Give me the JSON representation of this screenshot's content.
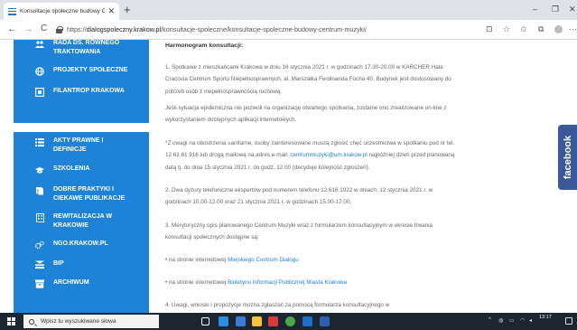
{
  "browser": {
    "tab_title": "Konsultacje społeczne budowy C",
    "tab_close": "✕",
    "new_tab": "+",
    "window_controls": {
      "minimize": "–",
      "restore": "❐",
      "close": "✕"
    },
    "nav": {
      "back": "←",
      "forward": "→",
      "reload": "C"
    },
    "url": {
      "scheme": "https://",
      "host": "dialogspoleczny.krakow.pl",
      "path": "/konsultacje-spoleczne/konsultacje-spoleczne-budowy-centrum-muzyki/"
    },
    "toolbar_icons": [
      "reader-icon",
      "favorite-icon",
      "favorites-list-icon",
      "collections-icon",
      "profile-icon",
      "more-icon"
    ]
  },
  "sidebar": {
    "group1": [
      {
        "label": "RADA DS. ROWNEGO TRAKTOWANIA",
        "icon": "people-icon"
      },
      {
        "label": "PROJEKTY SPOŁECZNE",
        "icon": "globe-icon"
      },
      {
        "label": "FILANTROP KRAKOWA",
        "icon": "card-icon"
      }
    ],
    "group2": [
      {
        "label": "AKTY PRAWNE I DEFINICJE",
        "icon": "list-icon"
      },
      {
        "label": "SZKOLENIA",
        "icon": "graduation-cap-icon"
      },
      {
        "label": "DOBRE PRAKTYKI I CIEKAWE PUBLIKACJE",
        "icon": "book-icon"
      },
      {
        "label": "REWITALIZACJA W KRAKOWIE",
        "icon": "building-icon"
      },
      {
        "label": "NGO.KRAKOW.PL",
        "icon": "gears-icon"
      },
      {
        "label": "BIP",
        "icon": "bip-icon"
      },
      {
        "label": "ARCHIWUM",
        "icon": "archive-icon"
      }
    ]
  },
  "content": {
    "heading": "Harmonogram konsultacji:",
    "p1": "1. Spotkanie z mieszkańcami Krakowa w dniu 16 stycznia 2021 r. w godzinach 17.30-20.00 w KARCHER Hala Cracovia Centrum Sportu Niepełnosprawnych, al. Marszałka Ferdinanda Focha 40. Budynek jest dostosowany do potrzeb osób z niepełnosprawnością ruchową.",
    "p2": "Jeśli sytuacja epidemiczna nie pozwoli na organizację otwartego spotkania, zostanie ono zrealizowane on-line z wykorzystaniem dostępnych aplikacji internetowych.",
    "p3_before": "*Z uwagi na obostrzenia sanitarne, osoby zainteresowane muszą zgłosić chęć uczestnictwa w spotkaniu pod nr tel. 12 61 61 916 lub drogą mailową na adres e-mail: ",
    "p3_email": "centrummuzyki@um.krakow.pl",
    "p3_after": " najpóźniej dzień przed planowaną datą tj. do dnia 15 stycznia 2021 r. do godz. 12.00 (decyduje kolejność zgłoszeń).",
    "p4": "2. Dwa dyżury telefoniczne ekspertów pod numerem telefonu 12 616 1922 w dniach: 12 stycznia 2021 r. w godzinach 10.00-12.00 oraz 21 stycznia 2021 r. w godzinach 15.00-17.00.",
    "p5": "3. Merytoryczny opis planowanego Centrum Muzyki wraz z formularzem konsultacyjnym w okresie trwania konsultacji społecznych dostępne są:",
    "p6_before": "• na stronie internetowej ",
    "p6_link": "Miejskiego Centrum Dialogu",
    "p7_before": "• na stronie internetowej ",
    "p7_link": "Biuletynu Informacji Publicznej Miasta Krakowa",
    "p8": "4. Uwagi, wnioski i propozycje można zgłaszać za pomocą formularza konsultacyjnego w"
  },
  "facebook_tab": {
    "label": "facebook"
  },
  "taskbar": {
    "search_placeholder": "Wpisz tu wyszukiwane słowa",
    "apps": [
      {
        "name": "task-view-icon",
        "color": "#ffffff"
      },
      {
        "name": "edge-icon",
        "color": "#2a8fe0"
      },
      {
        "name": "mail-icon",
        "color": "#3a7bd5"
      },
      {
        "name": "file-explorer-icon",
        "color": "#f4c33b"
      },
      {
        "name": "store-icon",
        "color": "#d83b3b"
      },
      {
        "name": "chrome-icon",
        "color": "#4aa74a"
      },
      {
        "name": "outlook-icon",
        "color": "#1e6fc9"
      },
      {
        "name": "word-icon",
        "color": "#2b5fb4"
      }
    ],
    "time": "13:17"
  }
}
